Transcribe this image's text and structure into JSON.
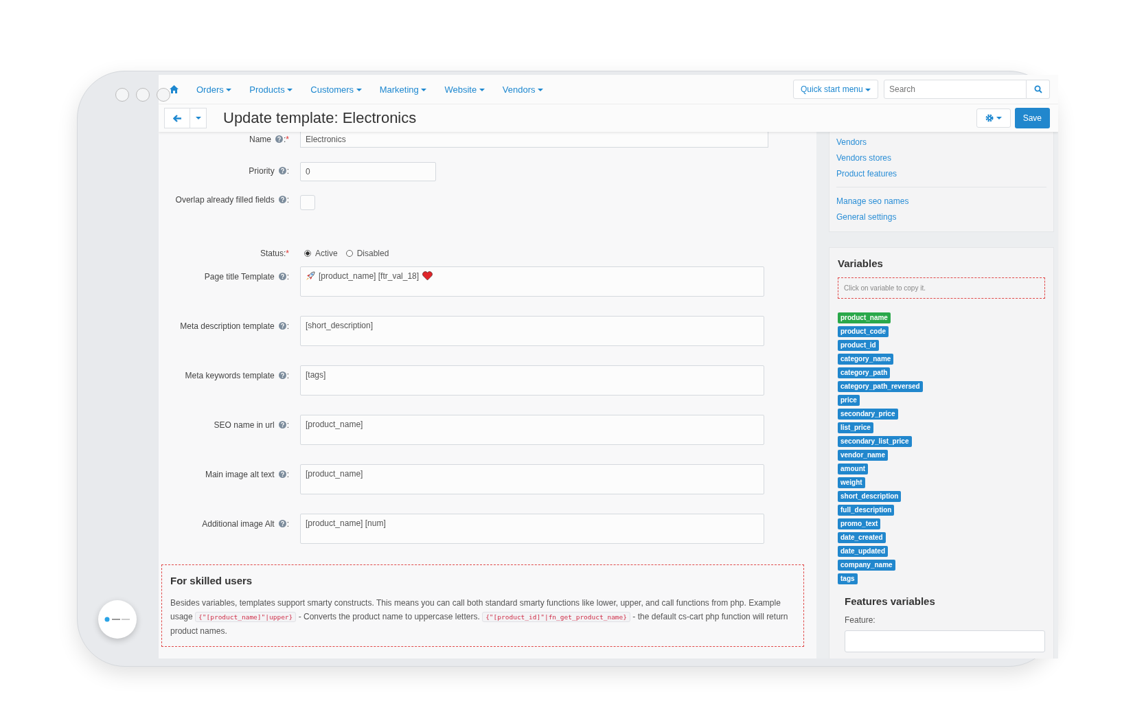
{
  "nav": {
    "items": [
      {
        "label": "Orders"
      },
      {
        "label": "Products"
      },
      {
        "label": "Customers"
      },
      {
        "label": "Marketing"
      },
      {
        "label": "Website"
      },
      {
        "label": "Vendors"
      }
    ],
    "quick_start": "Quick start menu",
    "search": {
      "placeholder": "Search"
    }
  },
  "toolbar": {
    "title": "Update template: Electronics",
    "save": "Save"
  },
  "form": {
    "fields": [
      {
        "kind": "text",
        "label": "Name",
        "help": true,
        "colon": ":",
        "required_mark": "*",
        "value": "Electronics"
      },
      {
        "kind": "short",
        "label": "Priority",
        "help": true,
        "colon": ":",
        "value": "0"
      },
      {
        "kind": "checkbox",
        "label": "Overlap already filled fields",
        "help": true,
        "colon": ":",
        "checked": false
      },
      {
        "kind": "radio",
        "label": "Status:",
        "required_mark": "*",
        "options": [
          {
            "label": "Active",
            "selected": true
          },
          {
            "label": "Disabled",
            "selected": false
          }
        ]
      },
      {
        "kind": "textarea",
        "label": "Page title Template",
        "help": true,
        "colon": ":",
        "value": "[product_name] [ftr_val_18]",
        "emoji": true
      },
      {
        "kind": "textarea",
        "label": "Meta description template",
        "help": true,
        "colon": ":",
        "value": "[short_description]"
      },
      {
        "kind": "textarea",
        "label": "Meta keywords template",
        "help": true,
        "colon": ":",
        "value": "[tags]"
      },
      {
        "kind": "textarea",
        "label": "SEO name in url",
        "help": true,
        "colon": ":",
        "value": "[product_name]"
      },
      {
        "kind": "textarea",
        "label": "Main image alt text",
        "help": true,
        "colon": ":",
        "value": "[product_name]"
      },
      {
        "kind": "textarea",
        "label": "Additional image Alt",
        "help": true,
        "colon": ":",
        "value": "[product_name] [num]"
      }
    ]
  },
  "skilled": {
    "title": "For skilled users",
    "parts": [
      {
        "kind": "text",
        "text": "Besides variables, templates support smarty constructs. This means you can call both standard smarty functions like lower, upper, and call functions from php. Example usage "
      },
      {
        "kind": "code",
        "text": "{\"[product_name]\"|upper}"
      },
      {
        "kind": "text",
        "text": " - Converts the product name to uppercase letters. "
      },
      {
        "kind": "code",
        "text": "{\"[product_id]\"|fn_get_product_name}"
      },
      {
        "kind": "text",
        "text": " - the default cs-cart php function will return product names."
      }
    ]
  },
  "sidebar": {
    "link_groups": [
      [
        "Vendors",
        "Vendors stores",
        "Product features"
      ],
      [
        "Manage seo names",
        "General settings"
      ]
    ],
    "variables": {
      "title": "Variables",
      "hint": "Click on variable to copy it.",
      "items": [
        {
          "label": "product_name",
          "selected": true
        },
        {
          "label": "product_code",
          "selected": false
        },
        {
          "label": "product_id",
          "selected": false
        },
        {
          "label": "category_name",
          "selected": false
        },
        {
          "label": "category_path",
          "selected": false
        },
        {
          "label": "category_path_reversed",
          "selected": false
        },
        {
          "label": "price",
          "selected": false
        },
        {
          "label": "secondary_price",
          "selected": false
        },
        {
          "label": "list_price",
          "selected": false
        },
        {
          "label": "secondary_list_price",
          "selected": false
        },
        {
          "label": "vendor_name",
          "selected": false
        },
        {
          "label": "amount",
          "selected": false
        },
        {
          "label": "weight",
          "selected": false
        },
        {
          "label": "short_description",
          "selected": false
        },
        {
          "label": "full_description",
          "selected": false
        },
        {
          "label": "promo_text",
          "selected": false
        },
        {
          "label": "date_created",
          "selected": false
        },
        {
          "label": "date_updated",
          "selected": false
        },
        {
          "label": "company_name",
          "selected": false
        },
        {
          "label": "tags",
          "selected": false
        }
      ]
    },
    "features": {
      "title": "Features variables",
      "label": "Feature:"
    }
  }
}
